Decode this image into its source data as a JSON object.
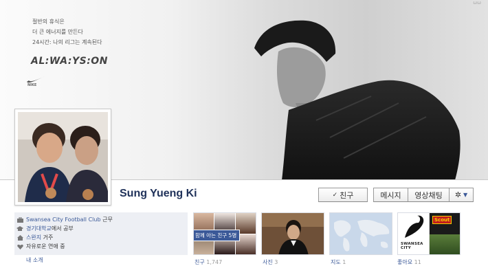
{
  "cover": {
    "slogan_lines": [
      "절반의 휴식은",
      "더 큰 에너지를 만든다",
      "24시간: 나의 리그는 계속된다"
    ],
    "tagline": "AL:WA:YS:ON",
    "brand_text": "NIKE",
    "corner_text": "ωω"
  },
  "profile": {
    "name": "Sung Yueng Ki"
  },
  "actions": {
    "friend_label": "친구",
    "friend_check": "✓",
    "message_label": "메시지",
    "video_label": "영상채팅",
    "gear_glyph": "✲",
    "gear_caret": "▼"
  },
  "info": {
    "work_link": "Swansea City Football Club",
    "work_suffix": "근무",
    "school_link": "경기대학교",
    "school_suffix": "에서 공부",
    "city_link": "스완지",
    "city_suffix": "거주",
    "relationship": "자유로운 연애 중",
    "about_link": "내 소개"
  },
  "tiles": {
    "friends": {
      "label": "친구",
      "count": "1,747",
      "badge": "함께 아는 친구 5명"
    },
    "photos": {
      "label": "사진",
      "count": "3"
    },
    "map": {
      "label": "지도",
      "count": "1"
    },
    "likes": {
      "label": "좋아요",
      "count": "11",
      "caption": "SWANSEA CITY",
      "badge_text": "Scout"
    }
  },
  "colors": {
    "link": "#3b5998",
    "name": "#20325a",
    "info_bg": "#edeff4"
  }
}
